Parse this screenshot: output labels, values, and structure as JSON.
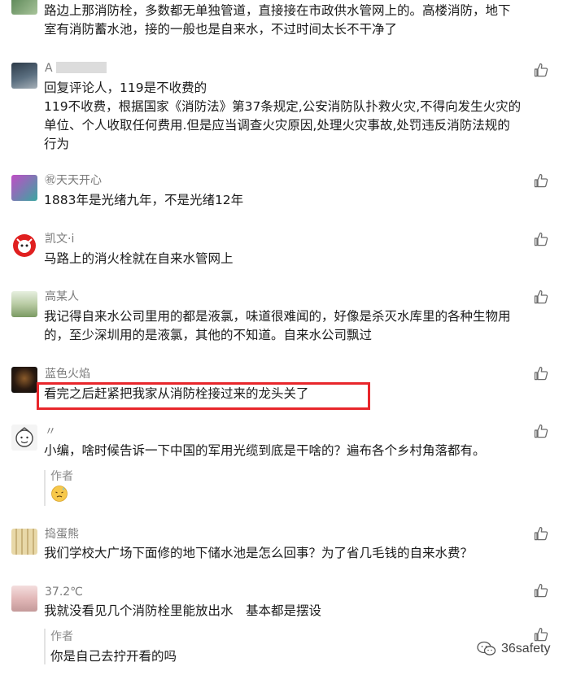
{
  "comments": [
    {
      "name": "",
      "lines": [
        "路边上那消防栓，多数都无单独管道，直接接在市政供水管网上的。高楼消防，地下",
        "室有消防蓄水池，接的一般也是自来水，不过时间太长不干净了"
      ]
    },
    {
      "name": "A",
      "lines": [
        "回复评论人，119是不收费的",
        "119不收费，根据国家《消防法》第37条规定,公安消防队扑救火灾,不得向发生火灾的",
        "单位、个人收取任何费用.但是应当调查火灾原因,处理火灾事故,处罚违反消防法规的",
        "行为"
      ]
    },
    {
      "name": "㊗天天开心",
      "lines": [
        "1883年是光绪九年，不是光绪12年"
      ]
    },
    {
      "name": "凯文·i",
      "lines": [
        "马路上的消火栓就在自来水管网上"
      ]
    },
    {
      "name": "高某人",
      "lines": [
        "我记得自来水公司里用的都是液氯，味道很难闻的，好像是杀灭水库里的各种生物用",
        "的，至少深圳用的是液氯，其他的不知道。自来水公司飘过"
      ]
    },
    {
      "name": "蓝色火焰",
      "lines": [
        "看完之后赶紧把我家从消防栓接过来的龙头关了"
      ]
    },
    {
      "name": "〃",
      "lines": [
        "小编，啥时候告诉一下中国的军用光缆到底是干啥的？遍布各个乡村角落都有。"
      ],
      "reply": {
        "author": "作者",
        "text": "😥"
      }
    },
    {
      "name": "捣蛋熊",
      "lines": [
        "我们学校大广场下面修的地下储水池是怎么回事？为了省几毛钱的自来水费？"
      ]
    },
    {
      "name": "37.2℃",
      "lines": [
        "我就没看见几个消防栓里能放出水　基本都是摆设"
      ],
      "reply": {
        "author": "作者",
        "text": "你是自己去拧开看的吗"
      }
    }
  ],
  "watermark": "36safety",
  "colors": {
    "highlight": "#e8262b",
    "name": "#7a7a7a",
    "text": "#1a1a1a"
  }
}
